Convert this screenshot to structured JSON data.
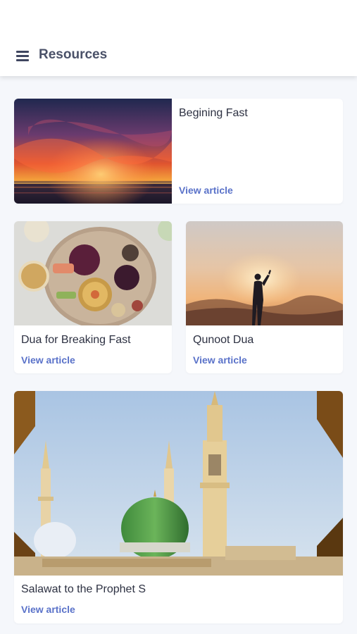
{
  "header": {
    "title": "Resources",
    "menu_icon": "hamburger-menu-icon"
  },
  "cards": [
    {
      "title": "Begining Fast",
      "link": "View article",
      "image": "sunset-over-water"
    },
    {
      "title": "Dua for Breaking Fast",
      "link": "View article",
      "image": "food-platter"
    },
    {
      "title": "Qunoot Dua",
      "link": "View article",
      "image": "person-praying-silhouette"
    },
    {
      "title": "Salawat to the Prophet S",
      "link": "View article",
      "image": "green-dome-mosque"
    }
  ],
  "colors": {
    "accent": "#5a72c9",
    "background": "#f5f7fb",
    "title_text": "#4a5168"
  }
}
